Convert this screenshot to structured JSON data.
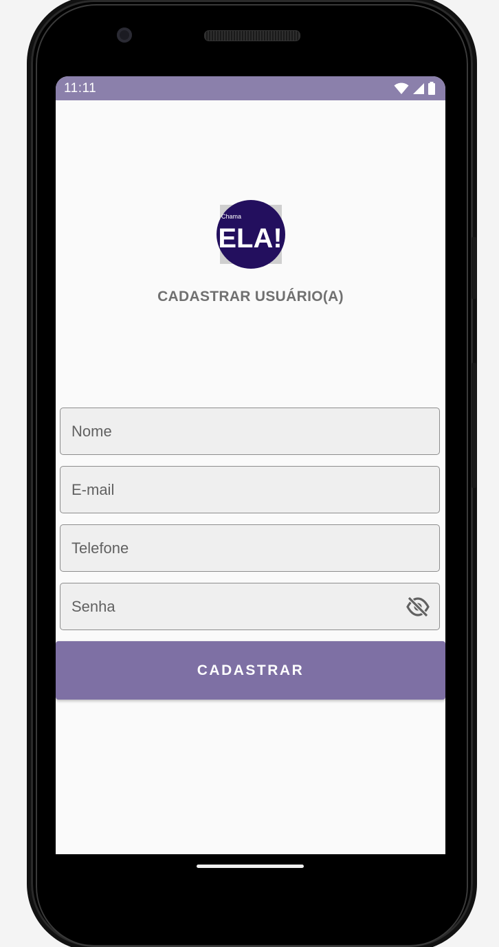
{
  "status_bar": {
    "time": "11:11",
    "icons": [
      "wifi-icon",
      "cell-signal-icon",
      "battery-icon"
    ],
    "background": "#8b80ab"
  },
  "logo": {
    "small_text": "Chama",
    "big_text": "ELA!",
    "color": "#230f5e"
  },
  "page": {
    "title": "CADASTRAR USUÁRIO(A)"
  },
  "form": {
    "name_placeholder": "Nome",
    "email_placeholder": "E-mail",
    "phone_placeholder": "Telefone",
    "password_placeholder": "Senha",
    "password_toggle_icon": "eye-off-icon",
    "submit_label": "CADASTRAR",
    "accent_color": "#7e70a4"
  }
}
